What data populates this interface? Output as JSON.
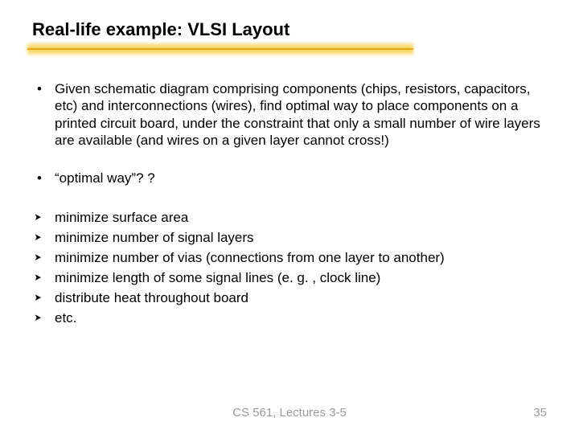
{
  "title": "Real-life example: VLSI Layout",
  "bullets": [
    "Given schematic diagram comprising components (chips, resistors, capacitors, etc) and interconnections (wires), find optimal way to place components on a printed circuit board, under the constraint that only a small number of wire layers are available (and wires on a given layer cannot cross!)",
    "“optimal way”? ?"
  ],
  "arrows": [
    "minimize surface area",
    "minimize number of signal layers",
    "minimize number of vias (connections from one layer to another)",
    "minimize length of some signal lines (e. g. , clock line)",
    "distribute heat throughout board",
    "etc."
  ],
  "footer": {
    "center": "CS 561, Lectures 3-5",
    "page": "35"
  }
}
